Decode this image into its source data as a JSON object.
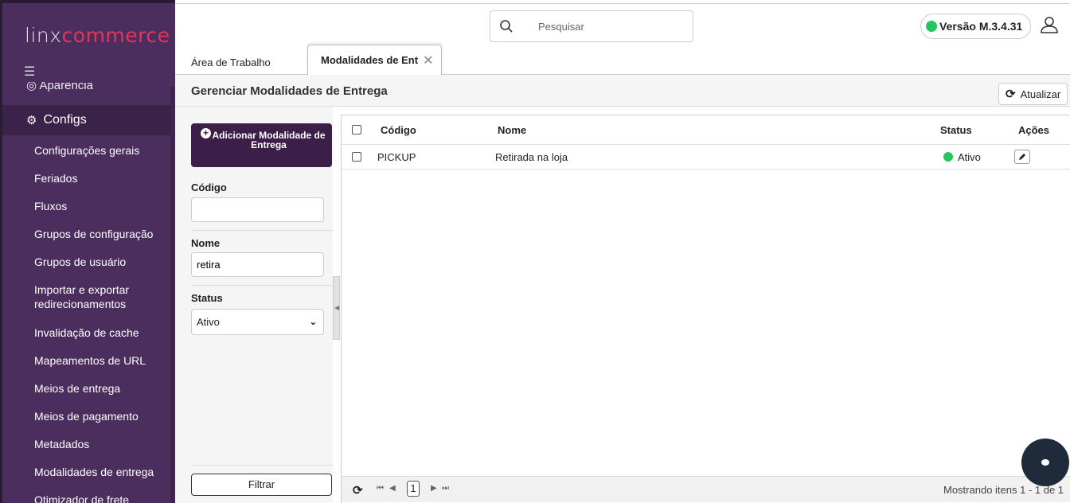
{
  "sidebar": {
    "logo_part1": "linx",
    "logo_part2": "commerce",
    "menu_icon": "☰",
    "prev_section": "Aparência",
    "section": "Configs",
    "items": [
      {
        "label": "Configurações gerais"
      },
      {
        "label": "Feriados"
      },
      {
        "label": "Fluxos"
      },
      {
        "label": "Grupos de configuração"
      },
      {
        "label": "Grupos de usuário"
      },
      {
        "label": "Importar e exportar redirecionamentos"
      },
      {
        "label": "Invalidação de cache"
      },
      {
        "label": "Mapeamentos de URL"
      },
      {
        "label": "Meios de entrega"
      },
      {
        "label": "Meios de pagamento"
      },
      {
        "label": "Metadados"
      },
      {
        "label": "Modalidades de entrega"
      },
      {
        "label": "Otimizador de frete"
      }
    ]
  },
  "topbar": {
    "search_placeholder": "Pesquisar",
    "version_label": "Versão M.3.4.31",
    "version_color": "#22c55e"
  },
  "tabs": [
    {
      "label": "Área de Trabalho"
    },
    {
      "label": "Modalidades de Ent"
    }
  ],
  "page": {
    "title": "Gerenciar Modalidades de Entrega",
    "refresh_label": "Atualizar"
  },
  "filter": {
    "add_label": "Adicionar Modalidade de Entrega",
    "code_label": "Código",
    "code_value": "",
    "name_label": "Nome",
    "name_value": "retira",
    "status_label": "Status",
    "status_value": "Ativo",
    "filter_button": "Filtrar"
  },
  "grid": {
    "columns": {
      "code": "Código",
      "name": "Nome",
      "status": "Status",
      "actions": "Ações"
    },
    "rows": [
      {
        "code": "PICKUP",
        "name": "Retirada na loja",
        "status": "Ativo"
      }
    ],
    "pager": {
      "page": "1",
      "info": "Mostrando itens 1 - 1 de 1"
    }
  },
  "brand_colors": {
    "sidebar": "#4b2d5e",
    "accent": "#e0365a",
    "primary_button": "#3c1f48"
  }
}
